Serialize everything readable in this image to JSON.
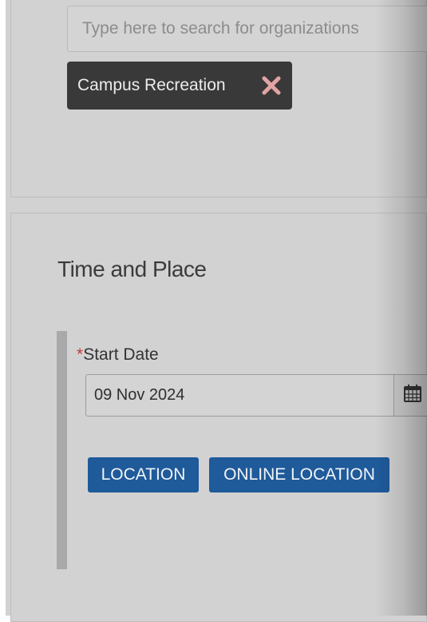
{
  "organizations": {
    "search_placeholder": "Type here to search for organizations",
    "selected_tags": [
      {
        "label": "Campus Recreation",
        "remove_icon": "close-x-icon"
      }
    ]
  },
  "time_and_place": {
    "title": "Time and Place",
    "start_date": {
      "required_marker": "*",
      "label": "Start Date",
      "value": "09 Nov 2024",
      "calendar_icon": "calendar-icon"
    },
    "buttons": {
      "location": "LOCATION",
      "online_location": "ONLINE LOCATION"
    }
  },
  "colors": {
    "panel_background": "#d2d2d2",
    "tag_background": "#393939",
    "tag_remove_icon": "#e2a3a3",
    "button_primary": "#1f5a9a",
    "required_marker": "#c23b3b"
  }
}
